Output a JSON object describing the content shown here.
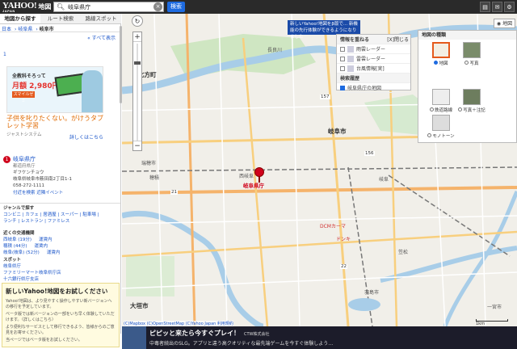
{
  "header": {
    "logo_main": "YAHOO!",
    "logo_japan": "JAPAN",
    "logo_sub": "地図",
    "search_value": "岐阜県庁",
    "search_button": "検索",
    "icons": [
      "printer-icon",
      "mail-icon",
      "settings-icon"
    ]
  },
  "tabs": [
    "地図から探す",
    "ルート検索",
    "路線スポット"
  ],
  "sidebar": {
    "breadcrumb": [
      "日本",
      "岐阜県",
      "岐阜市"
    ],
    "show_all": "すべて表示",
    "page_number": "1",
    "ad": {
      "headline1": "全教科そろって",
      "headline2": "月額 2,980円~",
      "brand": "スマイルゼミ",
      "tagline": "子供を叱りたくない。がけうタブレット学習",
      "sponsor": "ジャストシステム",
      "more": "詳しくはこちら"
    },
    "poi": {
      "title": "岐阜県庁",
      "category": "都道府県庁",
      "reading": "ギフケンチョウ",
      "address": "岐阜県岐阜市薮田南2丁目1-1",
      "phone": "058-272-1111",
      "links": "付近を検索 近隣イベント"
    },
    "genre": {
      "heading": "ジャンルで探す",
      "row1": "コンビニ | カフェ | 居酒屋 | スーパー | 駐車場 |",
      "row2": "ランチ | レストラン | ファミレス"
    },
    "transit": {
      "heading": "近くの交通機関",
      "items": [
        "西岐阜 (19分) 　 運賃内",
        "穂積 (44分) 　 運賃内",
        "岐阜(岐阜) (52分) 　 運賃内"
      ]
    },
    "spots": {
      "heading": "スポット",
      "items": [
        "岐阜県庁",
        "ファミリーマート岐阜県庁店",
        "十六銀行県庁支店"
      ]
    },
    "notice": {
      "heading": "新しいYahoo!地図をお試しください",
      "body1": "Yahoo!地図は、より見やすく操作しやすい新バージョンへの移行を予定しています。",
      "body2": "ベータ版では新バージョンの一部をいち早く体験していただけます。（詳しくはこちら）",
      "body3": "より便利なサービスとして移行できるよう、皆様からのご意見をお寄せください。",
      "body4": "当ページではベータ版をお試しください。"
    }
  },
  "map": {
    "banner_text": "新しいYahoo!地図をβ版で... 新機能の先行体験ができるようになりました",
    "mode_button": "地図",
    "layer_panel": {
      "header": "情報を重ねる",
      "close": "[X]閉じる",
      "items": [
        "雨雲レーダー",
        "雷雲レーダー",
        "台風情報[実]"
      ],
      "search_heading": "検索履歴",
      "search_item": "岐阜県庁の地図"
    },
    "type_panel": {
      "header": "地図の種類",
      "types": [
        "地図",
        "写真",
        "鉄道路線",
        "写真＋注記",
        "モノトーン"
      ]
    },
    "pin_label": "岐阜県庁",
    "labels": [
      {
        "text": "岐阜市",
        "cls": "big"
      },
      {
        "text": "大垣市",
        "cls": "big"
      },
      {
        "text": "北方町",
        "cls": "big"
      },
      {
        "text": "瑞穂市",
        "cls": ""
      },
      {
        "text": "穂積",
        "cls": ""
      },
      {
        "text": "西岐阜",
        "cls": ""
      },
      {
        "text": "岐阜",
        "cls": ""
      },
      {
        "text": "笠松",
        "cls": ""
      },
      {
        "text": "一宮市",
        "cls": ""
      },
      {
        "text": "羽島市",
        "cls": ""
      },
      {
        "text": "長良川",
        "cls": ""
      },
      {
        "text": "21",
        "cls": "road"
      },
      {
        "text": "157",
        "cls": "road"
      },
      {
        "text": "156",
        "cls": "road"
      },
      {
        "text": "22",
        "cls": "road"
      },
      {
        "text": "DCMカーマ",
        "cls": "red"
      },
      {
        "text": "ドンキ",
        "cls": "red"
      }
    ],
    "copyright": "(C)Mapbox (C)OpenStreetMap (C)Yahoo Japan 利用規約",
    "scale": "1km"
  },
  "bottom_ad": {
    "title": "ピピッと来たら今すぐプレイ！",
    "company": "CTW株式会社",
    "body": "中毒者続出のSLG。アプリと違う高クオリティな最先端ゲームを今すぐ体験しよう…"
  },
  "colors": {
    "accent": "#1e6be0",
    "pin": "#d0021b",
    "header": "#2a2a2a"
  }
}
